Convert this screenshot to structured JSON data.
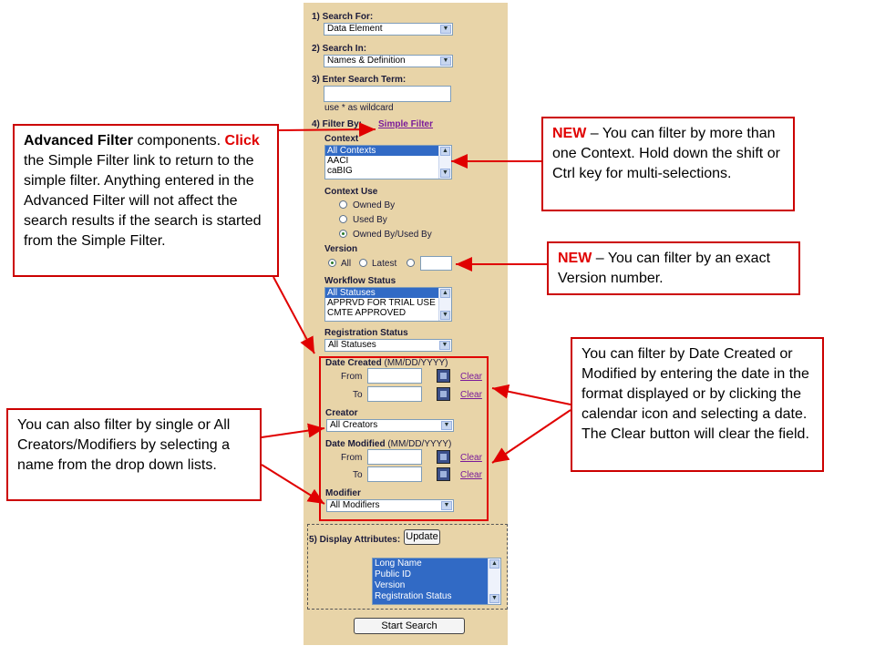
{
  "panel": {
    "step1": {
      "label": "1)  Search For:",
      "value": "Data Element"
    },
    "step2": {
      "label": "2)  Search In:",
      "value": "Names & Definition"
    },
    "step3": {
      "label": "3)  Enter Search Term:",
      "value": "",
      "hint": "use * as wildcard"
    },
    "step4": {
      "label": "4)  Filter By:",
      "link": "Simple Filter"
    },
    "context": {
      "label": "Context",
      "options": [
        "All Contexts",
        "AACI",
        "caBIG"
      ]
    },
    "context_use": {
      "label": "Context Use",
      "options": [
        "Owned By",
        "Used By",
        "Owned By/Used By"
      ],
      "selected": "Owned By/Used By"
    },
    "version": {
      "label": "Version",
      "all": "All",
      "latest": "Latest",
      "value": ""
    },
    "workflow": {
      "label": "Workflow Status",
      "options": [
        "All Statuses",
        "APPRVD FOR TRIAL USE",
        "CMTE APPROVED"
      ]
    },
    "registration": {
      "label": "Registration Status",
      "value": "All Statuses"
    },
    "date_created": {
      "label": "Date Created",
      "format": "(MM/DD/YYYY)",
      "from": "From",
      "to": "To",
      "clear": "Clear"
    },
    "creator": {
      "label": "Creator",
      "value": "All Creators"
    },
    "date_modified": {
      "label": "Date Modified",
      "format": "(MM/DD/YYYY)",
      "from": "From",
      "to": "To",
      "clear": "Clear"
    },
    "modifier": {
      "label": "Modifier",
      "value": "All Modifiers"
    },
    "step5": {
      "label": "5)  Display Attributes:",
      "update": "Update",
      "options": [
        "Long Name",
        "Public ID",
        "Version",
        "Registration Status"
      ]
    },
    "start_search": "Start Search"
  },
  "callouts": {
    "advanced": {
      "bold": "Advanced Filter",
      "t1": " components. ",
      "click": "Click",
      "t2": " the Simple Filter link to return to the simple filter. Anything entered in the Advanced Filter will not affect the search results if the search is started from the Simple Filter."
    },
    "context_new": {
      "new": "NEW",
      "text": " – You can filter by more than one Context. Hold down the shift or Ctrl key for multi-selections."
    },
    "version_new": {
      "new": "NEW",
      "text": " – You can filter by an exact Version number."
    },
    "dates": {
      "text": "You can filter by Date Created or Modified by entering the date in the format displayed or by clicking the calendar icon and selecting a date. The Clear button will clear the field."
    },
    "creators": {
      "text": "You can also filter by single or All Creators/Modifiers by selecting a name from the drop down lists."
    }
  },
  "colors": {
    "panel": "#e8d4a8",
    "callout_border": "#cc0000",
    "selection": "#316ac5"
  }
}
